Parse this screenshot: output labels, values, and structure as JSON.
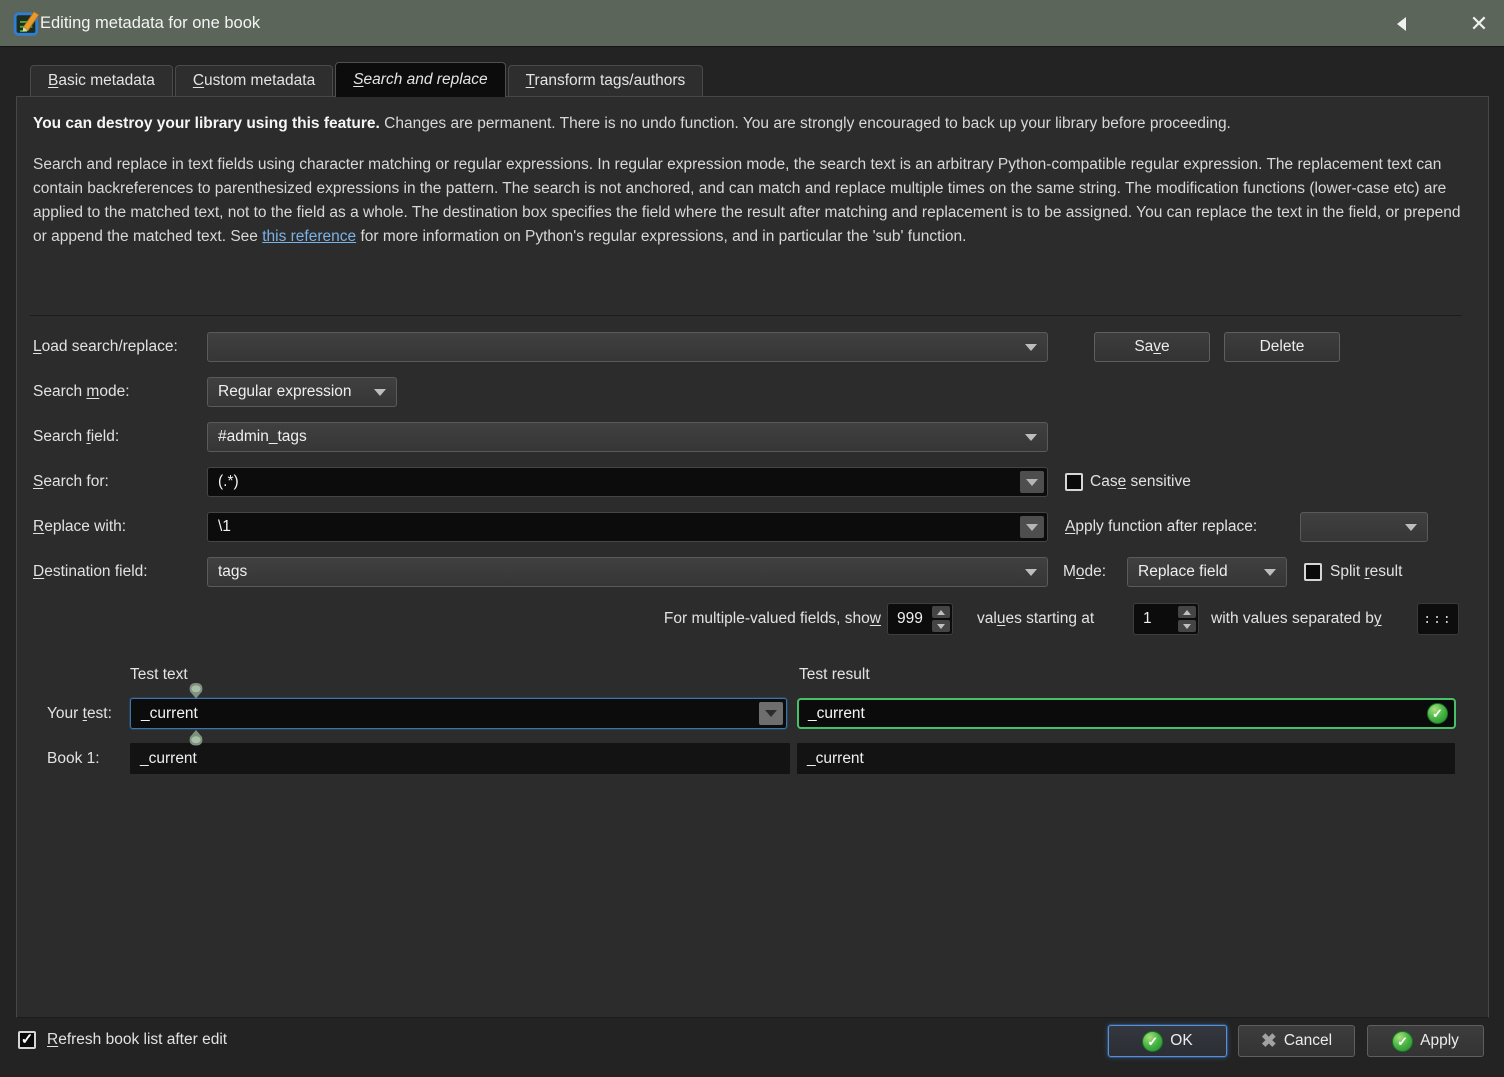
{
  "window": {
    "title": "Editing metadata for one book"
  },
  "tabs": [
    {
      "label": {
        "pre": "",
        "u": "B",
        "post": "asic metadata"
      },
      "active": false
    },
    {
      "label": {
        "pre": "",
        "u": "C",
        "post": "ustom metadata"
      },
      "active": false
    },
    {
      "label": {
        "pre": "",
        "u": "S",
        "post": "earch and replace"
      },
      "active": true
    },
    {
      "label": {
        "pre": "",
        "u": "T",
        "post": "ransform tags/authors"
      },
      "active": false
    }
  ],
  "intro": {
    "warning_bold": "You can destroy your library using this feature.",
    "warning_rest": " Changes are permanent. There is no undo function. You are strongly encouraged to back up your library before proceeding.",
    "desc_before": "Search and replace in text fields using character matching or regular expressions. In regular expression mode, the search text is an arbitrary Python-compatible regular expression. The replacement text can contain backreferences to parenthesized expressions in the pattern. The search is not anchored, and can match and replace multiple times on the same string. The modification functions (lower-case etc) are applied to the matched text, not to the field as a whole. The destination box specifies the field where the result after matching and replacement is to be assigned. You can replace the text in the field, or prepend or append the matched text. See ",
    "desc_link": "this reference",
    "desc_after": " for more information on Python's regular expressions, and in particular the 'sub' function."
  },
  "form": {
    "load": {
      "label": {
        "pre": "",
        "u": "L",
        "post": "oad search/replace:"
      },
      "value": ""
    },
    "save_button": {
      "pre": "Sa",
      "u": "v",
      "post": "e"
    },
    "delete_button": "Delete",
    "search_mode": {
      "label": {
        "pre": "Search ",
        "u": "m",
        "post": "ode:"
      },
      "value": "Regular expression"
    },
    "search_field": {
      "label": {
        "pre": "Search ",
        "u": "f",
        "post": "ield:"
      },
      "value": "#admin_tags"
    },
    "search_for": {
      "label": {
        "pre": "",
        "u": "S",
        "post": "earch for:"
      },
      "value": "(.*)"
    },
    "case_sensitive": {
      "label": {
        "pre": "Cas",
        "u": "e",
        "post": " sensitive"
      },
      "checked": false
    },
    "replace_with": {
      "label": {
        "pre": "",
        "u": "R",
        "post": "eplace with:"
      },
      "value": "\\1"
    },
    "apply_function": {
      "label": {
        "pre": "",
        "u": "A",
        "post": "pply function after replace:"
      },
      "value": ""
    },
    "destination": {
      "label": {
        "pre": "",
        "u": "D",
        "post": "estination field:"
      },
      "value": "tags"
    },
    "mode": {
      "label": {
        "pre": "M",
        "u": "o",
        "post": "de:"
      },
      "value": "Replace field"
    },
    "split_result": {
      "label": {
        "pre": "Split ",
        "u": "r",
        "post": "esult"
      },
      "checked": false
    },
    "multi": {
      "show_label": {
        "pre": "For multiple-valued fields, sho",
        "u": "w",
        "post": ""
      },
      "show_value": "999",
      "start_label": {
        "pre": "val",
        "u": "u",
        "post": "es starting at"
      },
      "start_value": "1",
      "sep_label": {
        "pre": "with values separated b",
        "u": "y",
        "post": ""
      },
      "sep_value": ":::"
    }
  },
  "test": {
    "text_header": "Test text",
    "result_header": "Test result",
    "your_test_label": {
      "pre": "Your ",
      "u": "t",
      "post": "est:"
    },
    "your_test_value": "_current",
    "your_test_result": "_current",
    "book1_label": "Book 1:",
    "book1_value": "_current",
    "book1_result": "_current"
  },
  "footer": {
    "refresh_label": {
      "pre": "",
      "u": "R",
      "post": "efresh book list after edit"
    },
    "refresh_checked": true,
    "ok_button": "OK",
    "cancel_button": "Cancel",
    "apply_button": "Apply"
  },
  "icons": {
    "close": "✕",
    "checkmark": "✓",
    "cancel_x": "✖"
  },
  "colors": {
    "titlebar": "#5b655a",
    "success_green": "#48c06a",
    "focus_blue": "#3f74a3",
    "link_blue": "#7cb2e8"
  }
}
